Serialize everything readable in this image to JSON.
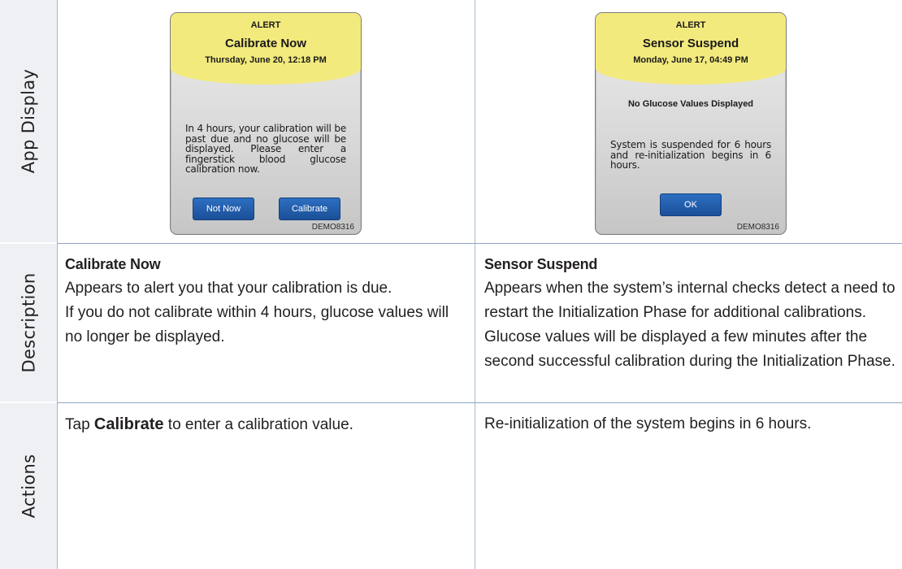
{
  "rows": {
    "app_display": "App Display",
    "description": "Description",
    "actions": "Actions"
  },
  "left_screen": {
    "alert_word": "ALERT",
    "title": "Calibrate Now",
    "date": "Thursday, June 20, 12:18 PM",
    "message": "In 4 hours, your calibration will be past due and no glucose will be displayed. Please enter a fingerstick blood glucose calibration now.",
    "buttons": {
      "not_now": "Not Now",
      "calibrate": "Calibrate"
    },
    "demo_id": "DEMO8316",
    "colors": {
      "header": "#f2ea7d",
      "button": "#1f5aa8"
    }
  },
  "right_screen": {
    "alert_word": "ALERT",
    "title": "Sensor Suspend",
    "date": "Monday, June 17, 04:49 PM",
    "subhead": "No Glucose Values Displayed",
    "message": "System is suspended for 6 hours and re-initialization begins in 6 hours.",
    "buttons": {
      "ok": "OK"
    },
    "demo_id": "DEMO8316"
  },
  "left_description": {
    "heading": "Calibrate Now",
    "body_1": "Appears to alert you that your calibration is due.",
    "body_2": "If you do not calibrate within 4 hours, glucose values will no longer be displayed."
  },
  "right_description": {
    "heading": "Sensor Suspend",
    "body": "Appears when the system’s internal checks detect a need to restart the Initialization Phase for additional calibrations. Glucose values will be displayed a few minutes after the second successful calibration during the Initialization Phase."
  },
  "left_action": {
    "prefix": "Tap ",
    "emphasis": "Calibrate",
    "suffix": " to enter a calibration value."
  },
  "right_action": {
    "text": "Re-initialization of the system begins in 6 hours."
  }
}
